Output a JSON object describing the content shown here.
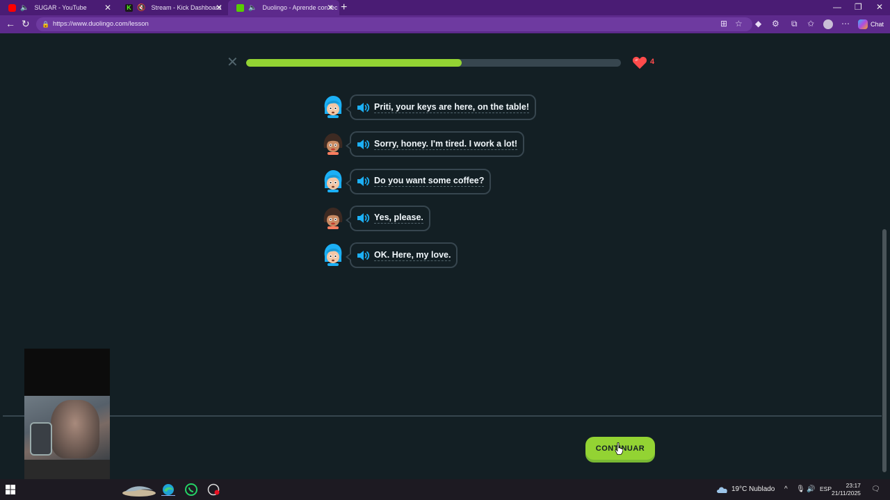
{
  "browser": {
    "tabs": [
      {
        "title": "SUGAR - YouTube",
        "favicon_color": "#ff0000"
      },
      {
        "title": "Stream - Kick Dashboard",
        "favicon_color": "#53fc18"
      },
      {
        "title": "Duolingo - Aprende con lec",
        "favicon_color": "#58cc02"
      }
    ],
    "url": "https://www.duolingo.com/lesson",
    "chat_label": "Chat"
  },
  "lesson": {
    "progress_fraction": 0.575,
    "hearts": "4",
    "dialog": [
      {
        "speaker": "blue-haired-character",
        "text": "Priti, your keys are here, on the table!"
      },
      {
        "speaker": "dark-haired-character",
        "text": "Sorry, honey. I'm tired. I work a lot!"
      },
      {
        "speaker": "blue-haired-character",
        "text": "Do you want some coffee?"
      },
      {
        "speaker": "dark-haired-character",
        "text": "Yes, please."
      },
      {
        "speaker": "blue-haired-character",
        "text": "OK. Here, my love."
      }
    ],
    "continue_label": "CONTINUAR"
  },
  "colors": {
    "accent_green": "#93d333",
    "heart_red": "#ff4b4b",
    "page_bg": "#131f24"
  },
  "taskbar": {
    "weather": "19°C  Nublado",
    "language": "ESP",
    "time": "23:17",
    "date": "21/11/2025"
  }
}
